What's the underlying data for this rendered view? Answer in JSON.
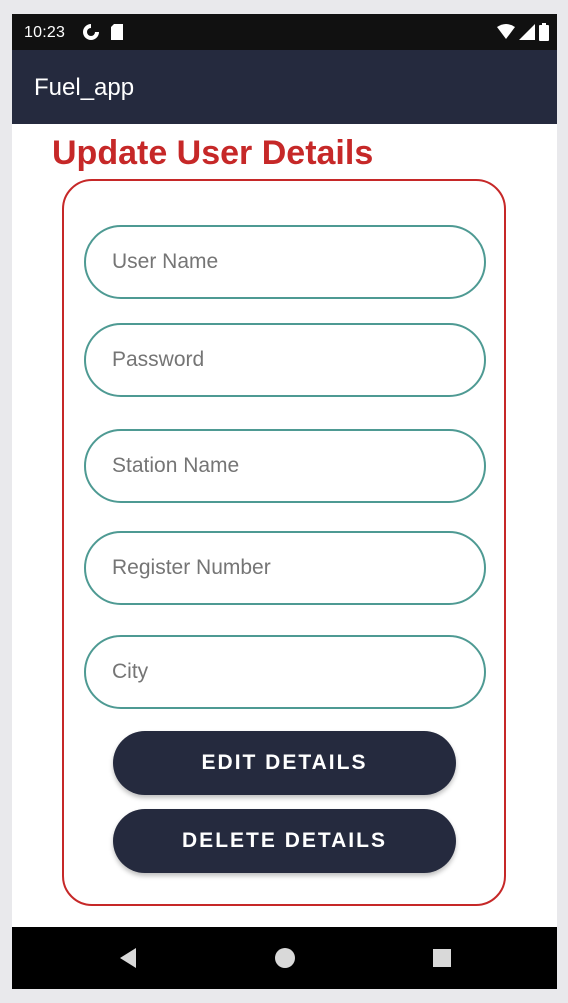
{
  "status_bar": {
    "time": "10:23",
    "left_icons": [
      "sync-icon",
      "sd-card-icon"
    ],
    "right_icons": [
      "wifi-icon",
      "signal-icon",
      "battery-icon"
    ]
  },
  "app_bar": {
    "title": "Fuel_app"
  },
  "page": {
    "title": "Update User Details"
  },
  "form": {
    "fields": [
      {
        "placeholder": "User Name",
        "value": ""
      },
      {
        "placeholder": "Password",
        "value": ""
      },
      {
        "placeholder": "Station Name",
        "value": ""
      },
      {
        "placeholder": "Register Number",
        "value": ""
      },
      {
        "placeholder": "City",
        "value": ""
      }
    ],
    "edit_button": "EDIT DETAILS",
    "delete_button": "DELETE DETAILS"
  },
  "nav_bar": {
    "items": [
      "back-icon",
      "home-icon",
      "recents-icon"
    ]
  },
  "colors": {
    "app_bar": "#252a3e",
    "title_red": "#c62828",
    "field_border": "#4e9a93",
    "button": "#252a3e"
  }
}
